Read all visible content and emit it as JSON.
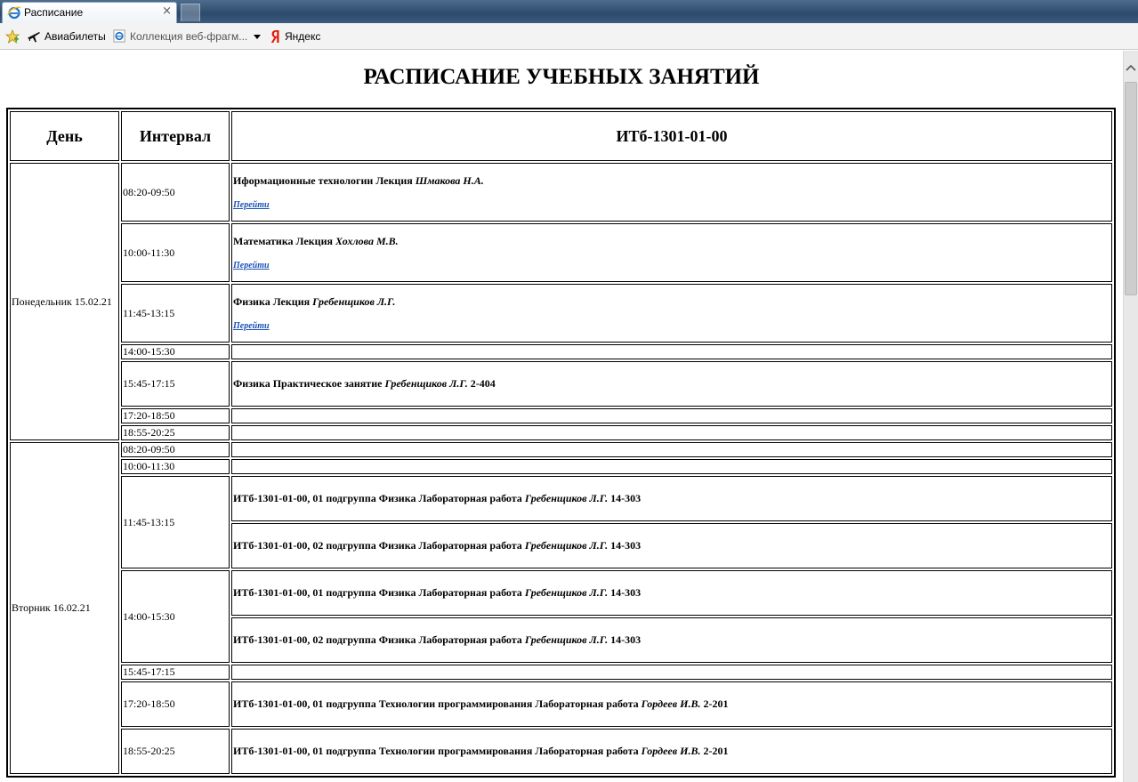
{
  "browser": {
    "tab_title": "Расписание",
    "tab_close": "×",
    "favorites": [
      {
        "label": "Авиабилеты",
        "icon": "airplane-icon"
      },
      {
        "label": "Коллекция веб-фрагм...",
        "icon": "ie-icon"
      },
      {
        "label": "Яндекс",
        "icon": "yandex-icon"
      }
    ]
  },
  "page": {
    "title": "РАСПИСАНИЕ УЧЕБНЫХ ЗАНЯТИЙ",
    "headers": {
      "day": "День",
      "interval": "Интервал",
      "group": "ИТб-1301-01-00"
    },
    "link_label": "Перейти"
  },
  "days": [
    {
      "day": "Понедельник 15.02.21",
      "slots": [
        {
          "time": "08:20-09:50",
          "lessons": [
            {
              "text": "Иформационные технологии Лекция ",
              "teacher": "Шмакова Н.А.",
              "room": "",
              "link": true
            }
          ]
        },
        {
          "time": "10:00-11:30",
          "lessons": [
            {
              "text": "Математика Лекция ",
              "teacher": "Хохлова М.В.",
              "room": "",
              "link": true
            }
          ]
        },
        {
          "time": "11:45-13:15",
          "lessons": [
            {
              "text": "Физика Лекция ",
              "teacher": "Гребенщиков Л.Г.",
              "room": "",
              "link": true
            }
          ]
        },
        {
          "time": "14:00-15:30",
          "lessons": []
        },
        {
          "time": "15:45-17:15",
          "lessons": [
            {
              "text": "Физика Практическое занятие ",
              "teacher": "Гребенщиков Л.Г.",
              "room": " 2-404",
              "link": false
            }
          ]
        },
        {
          "time": "17:20-18:50",
          "lessons": []
        },
        {
          "time": "18:55-20:25",
          "lessons": []
        }
      ]
    },
    {
      "day": "Вторник 16.02.21",
      "slots": [
        {
          "time": "08:20-09:50",
          "lessons": []
        },
        {
          "time": "10:00-11:30",
          "lessons": []
        },
        {
          "time": "11:45-13:15",
          "lessons": [
            {
              "text": "ИТб-1301-01-00, 01 подгруппа Физика Лабораторная работа ",
              "teacher": "Гребенщиков Л.Г.",
              "room": " 14-303",
              "link": false
            },
            {
              "text": "ИТб-1301-01-00, 02 подгруппа Физика Лабораторная работа ",
              "teacher": "Гребенщиков Л.Г.",
              "room": " 14-303",
              "link": false
            }
          ]
        },
        {
          "time": "14:00-15:30",
          "lessons": [
            {
              "text": "ИТб-1301-01-00, 01 подгруппа Физика Лабораторная работа ",
              "teacher": "Гребенщиков Л.Г.",
              "room": " 14-303",
              "link": false
            },
            {
              "text": "ИТб-1301-01-00, 02 подгруппа Физика Лабораторная работа ",
              "teacher": "Гребенщиков Л.Г.",
              "room": " 14-303",
              "link": false
            }
          ]
        },
        {
          "time": "15:45-17:15",
          "lessons": []
        },
        {
          "time": "17:20-18:50",
          "lessons": [
            {
              "text": "ИТб-1301-01-00, 01 подгруппа Технологии программирования Лабораторная работа ",
              "teacher": "Гордеев И.В.",
              "room": " 2-201",
              "link": false
            }
          ]
        },
        {
          "time": "18:55-20:25",
          "lessons": [
            {
              "text": "ИТб-1301-01-00, 01 подгруппа Технологии программирования Лабораторная работа ",
              "teacher": "Гордеев И.В.",
              "room": " 2-201",
              "link": false
            }
          ]
        }
      ]
    }
  ]
}
